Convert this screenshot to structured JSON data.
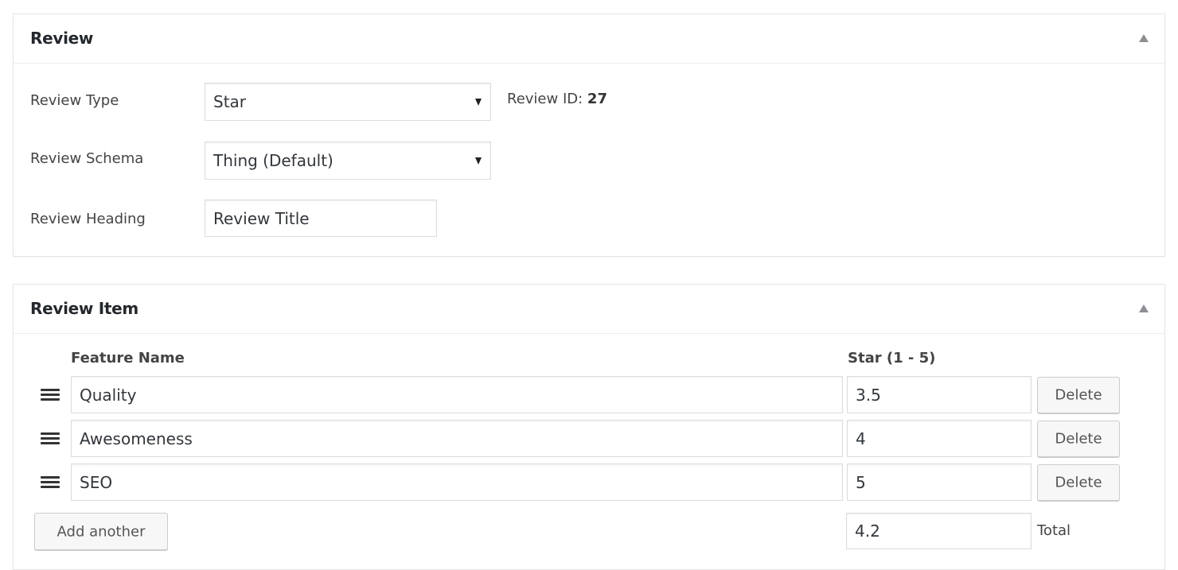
{
  "review_box": {
    "title": "Review",
    "toggle_icon": "arrow-up-icon",
    "fields": {
      "review_type": {
        "label": "Review Type",
        "value": "Star"
      },
      "review_schema": {
        "label": "Review Schema",
        "value": "Thing (Default)"
      },
      "review_heading": {
        "label": "Review Heading",
        "value": "Review Title"
      }
    },
    "review_id_label": "Review ID:",
    "review_id_value": "27"
  },
  "items_box": {
    "title": "Review Item",
    "toggle_icon": "arrow-up-icon",
    "columns": {
      "feature_name": "Feature Name",
      "star": "Star (1 - 5)"
    },
    "items": [
      {
        "name": "Quality",
        "star": "3.5",
        "delete_label": "Delete"
      },
      {
        "name": "Awesomeness",
        "star": "4",
        "delete_label": "Delete"
      },
      {
        "name": "SEO",
        "star": "5",
        "delete_label": "Delete"
      }
    ],
    "add_button_label": "Add another",
    "total_value": "4.2",
    "total_label": "Total"
  }
}
